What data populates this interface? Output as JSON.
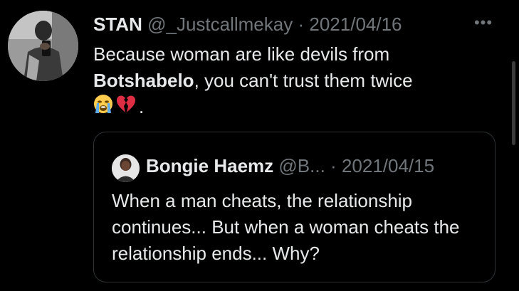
{
  "tweet": {
    "display_name": "STAN",
    "handle": "@_Justcallmekay",
    "separator": "·",
    "date": "2021/04/16",
    "text_part1": "Because woman are like devils from ",
    "text_bold": "Botshabelo",
    "text_part2": ", you can't trust them twice",
    "emoji_1": "crying-face-emoji",
    "emoji_2": "broken-heart-emoji",
    "text_end": ".",
    "more_icon": "more-horizontal-icon",
    "more_label": "•••"
  },
  "quoted_tweet": {
    "display_name": "Bongie Haemz",
    "handle": "@B...",
    "separator": "·",
    "date": "2021/04/15",
    "text": "When a man cheats, the relationship continues... But when a woman cheats the relationship ends... Why?"
  },
  "colors": {
    "background": "#000000",
    "primary_text": "#e7e9ea",
    "secondary_text": "#71767b",
    "border": "#2f3336"
  }
}
